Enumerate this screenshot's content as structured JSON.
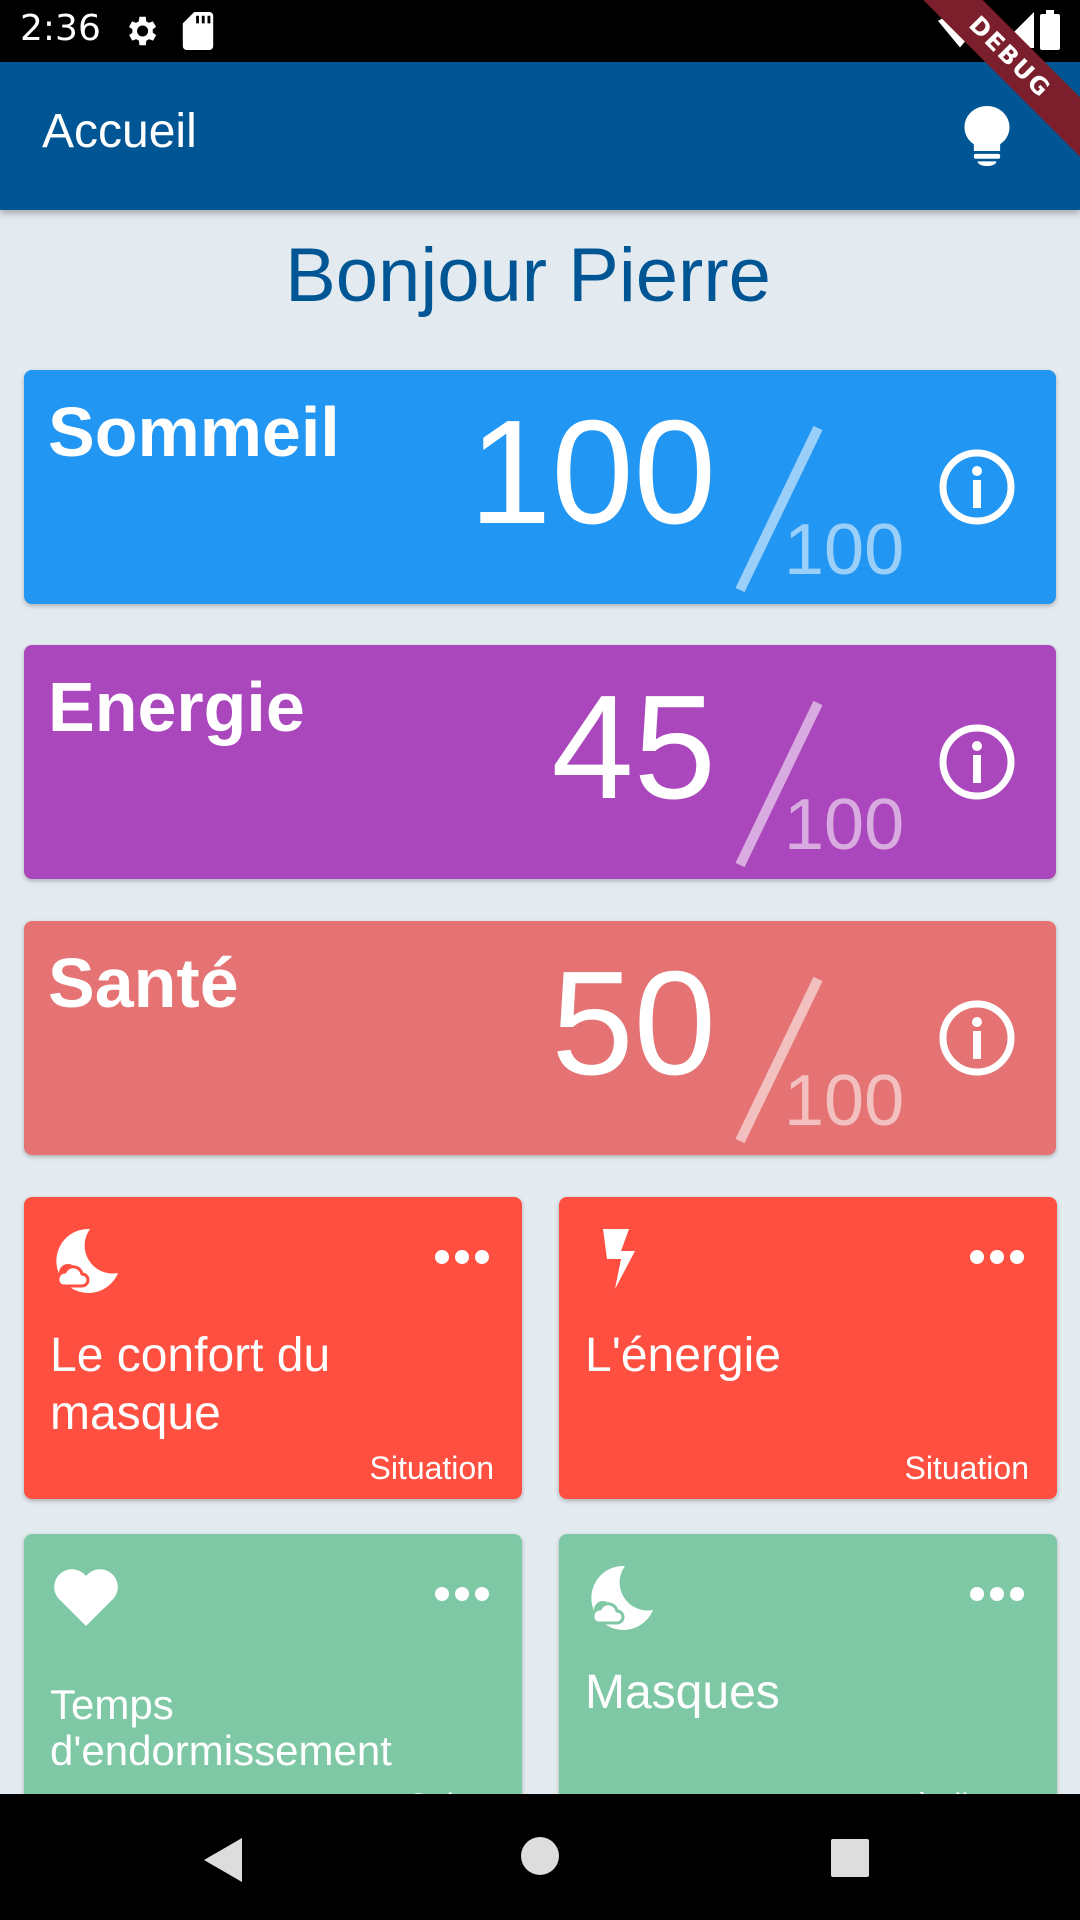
{
  "status_bar": {
    "time": "2:36",
    "debug": "DEBUG"
  },
  "app_bar": {
    "title": "Accueil",
    "action_icon": "lightbulb-icon"
  },
  "greeting": "Bonjour Pierre",
  "scores": [
    {
      "label": "Sommeil",
      "value": "100",
      "total": "100",
      "color": "#2196f3"
    },
    {
      "label": "Energie",
      "value": "45",
      "total": "100",
      "color": "#ab47bc"
    },
    {
      "label": "Santé",
      "value": "50",
      "total": "100",
      "color": "#e57373"
    }
  ],
  "tiles": [
    {
      "name": "Le confort du masque",
      "tag": "Situation",
      "icon": "moon-icon",
      "color": "#ff4f40"
    },
    {
      "name": "L'énergie",
      "tag": "Situation",
      "icon": "lightning-icon",
      "color": "#ff4f40"
    },
    {
      "name": "Temps d'endormissement",
      "tag": "Suiv...",
      "icon": "heart-icon",
      "color": "#7ec8a5"
    },
    {
      "name": "Masques",
      "tag": "...à-disp...",
      "icon": "moon-icon",
      "color": "#7ec8a5"
    }
  ]
}
